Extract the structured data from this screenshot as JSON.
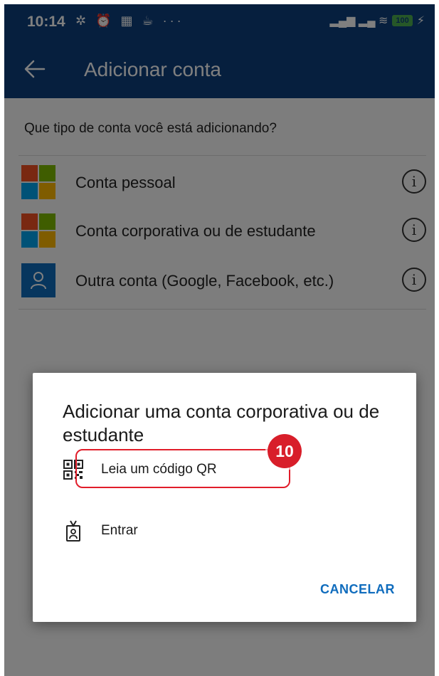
{
  "status_bar": {
    "time": "10:14",
    "left_icons": "✲ ⏰ ▦ ☕ ···",
    "signal_icons": "▂▄▆ ▂▄ ≋",
    "battery": "100",
    "charging": "⚡"
  },
  "app_bar": {
    "back_icon": "arrow-left-icon",
    "title": "Adicionar conta"
  },
  "main": {
    "question": "Que tipo de conta você está adicionando?",
    "accounts": [
      {
        "label": "Conta pessoal",
        "logo": "microsoft-logo"
      },
      {
        "label": "Conta corporativa ou de estudante",
        "logo": "microsoft-logo"
      },
      {
        "label": "Outra conta (Google, Facebook, etc.)",
        "logo": "person-icon"
      }
    ],
    "info_glyph": "i"
  },
  "dialog": {
    "title": "Adicionar uma conta corporativa ou de estudante",
    "options": [
      {
        "label": "Leia um código QR",
        "icon": "qr-code-icon"
      },
      {
        "label": "Entrar",
        "icon": "badge-icon"
      }
    ],
    "cancel": "CANCELAR",
    "step_badge": "10"
  },
  "colors": {
    "header": "#0c3f7d",
    "accent": "#0f6cbd",
    "highlight": "#e11d2a",
    "ms_red": "#f25022",
    "ms_green": "#7fba00",
    "ms_blue": "#00a4ef",
    "ms_yellow": "#ffb900"
  }
}
